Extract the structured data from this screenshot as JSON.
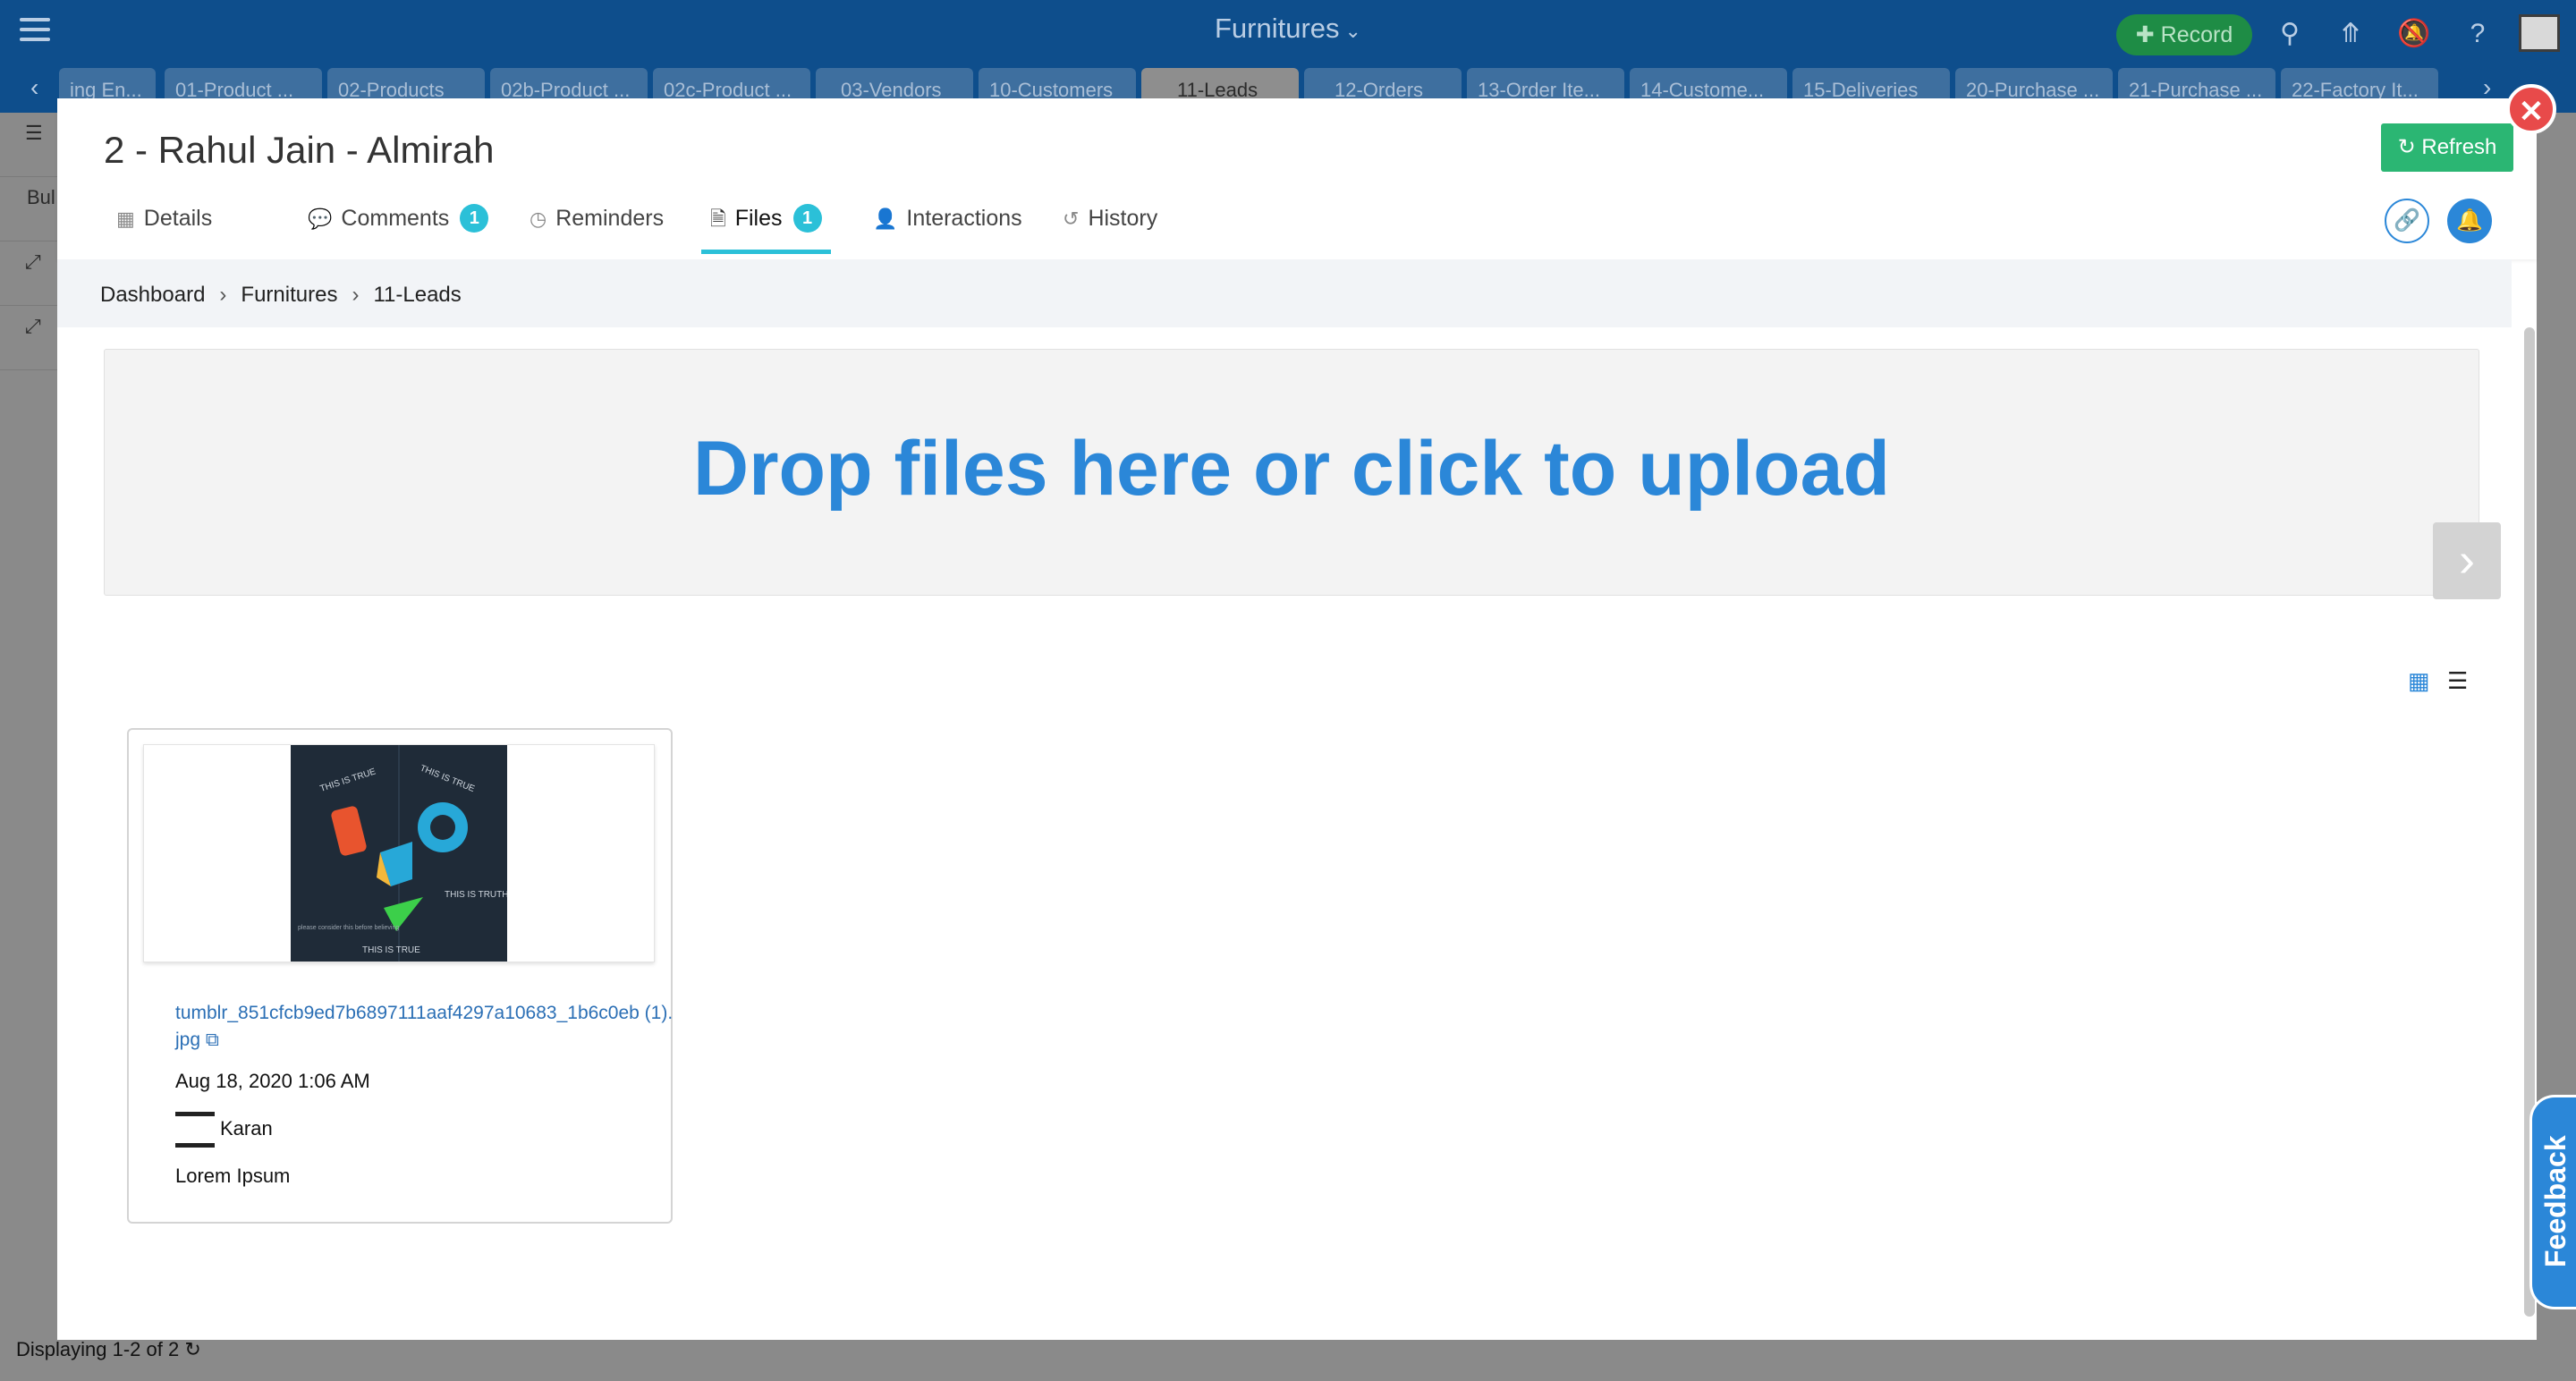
{
  "app": {
    "title": "Furnitures",
    "record_label": "Record"
  },
  "table_tabs": [
    "ing En...",
    "01-Product ...",
    "02-Products",
    "02b-Product ...",
    "02c-Product ...",
    "03-Vendors",
    "10-Customers",
    "11-Leads",
    "12-Orders",
    "13-Order Ite...",
    "14-Custome...",
    "15-Deliveries",
    "20-Purchase ...",
    "21-Purchase ...",
    "22-Factory It..."
  ],
  "active_table_tab": "11-Leads",
  "background": {
    "partial_label": "Bul",
    "footer_status": "Displaying 1-2 of 2"
  },
  "record": {
    "title": "2 - Rahul Jain - Almirah",
    "refresh_label": "Refresh",
    "tabs": {
      "details": "Details",
      "comments": "Comments",
      "comments_count": "1",
      "reminders": "Reminders",
      "files": "Files",
      "files_count": "1",
      "interactions": "Interactions",
      "history": "History"
    }
  },
  "breadcrumb": {
    "home": "Dashboard",
    "app": "Furnitures",
    "table": "11-Leads"
  },
  "upload": {
    "prompt": "Drop files here or click to upload"
  },
  "file": {
    "name": "tumblr_851cfcb9ed7b6897111aaf4297a10683_1b6c0eb (1).jpg",
    "date": "Aug 18, 2020 1:06 AM",
    "user": "Karan",
    "description": "Lorem Ipsum",
    "thumb_text": {
      "t1": "THIS IS TRUE",
      "t2": "THIS IS TRUE",
      "t3": "THIS IS TRUTH",
      "t4": "please consider this before believing",
      "t5": "THIS IS TRUE"
    }
  },
  "feedback_label": "Feedback",
  "colors": {
    "topbar": "#0e4e8c",
    "accent_blue": "#2b87d8",
    "tab_indicator": "#2bc0d8",
    "refresh_green": "#2bb673",
    "close_red": "#e84a4a"
  }
}
